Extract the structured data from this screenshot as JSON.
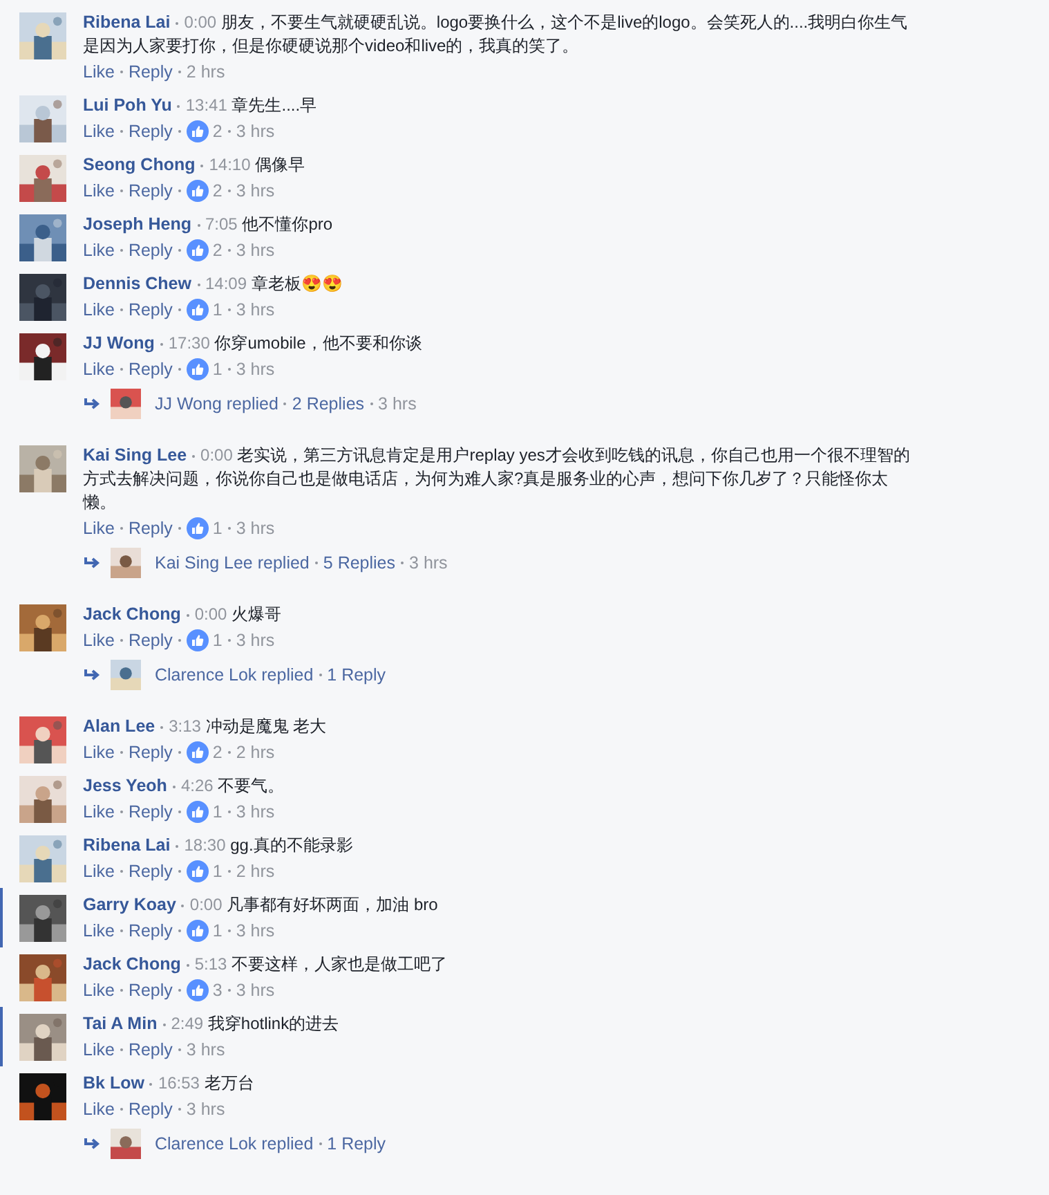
{
  "comments": [
    {
      "name": "Ribena Lai",
      "time": "0:00",
      "text": "朋友，不要生气就硬硬乱说。logo要换什么，这个不是live的logo。会笑死人的....我明白你生气是因为人家要打你，但是你硬硬说那个video和live的，我真的笑了。",
      "actions": [
        "Like",
        "Reply"
      ],
      "age": "2 hrs",
      "highlighted": false
    },
    {
      "name": "Lui Poh Yu",
      "time": "13:41",
      "text": "章先生....早",
      "actions": [
        "Like",
        "Reply"
      ],
      "likes": "2",
      "age": "3 hrs",
      "highlighted": false
    },
    {
      "name": "Seong Chong",
      "time": "14:10",
      "text": "偶像早",
      "actions": [
        "Like",
        "Reply"
      ],
      "likes": "2",
      "age": "3 hrs",
      "highlighted": false
    },
    {
      "name": "Joseph Heng",
      "time": "7:05",
      "text": "他不懂你pro",
      "actions": [
        "Like",
        "Reply"
      ],
      "likes": "2",
      "age": "3 hrs",
      "highlighted": false
    },
    {
      "name": "Dennis Chew",
      "time": "14:09",
      "text": "章老板😍😍",
      "actions": [
        "Like",
        "Reply"
      ],
      "likes": "1",
      "age": "3 hrs",
      "highlighted": false
    },
    {
      "name": "JJ Wong",
      "time": "17:30",
      "text": "你穿umobile，他不要和你谈",
      "actions": [
        "Like",
        "Reply"
      ],
      "likes": "1",
      "age": "3 hrs",
      "highlighted": false,
      "replies": {
        "label": "JJ Wong replied",
        "count": "2 Replies",
        "age": "3 hrs"
      }
    },
    {
      "name": "Kai Sing Lee",
      "time": "0:00",
      "text": "老实说，第三方讯息肯定是用户replay yes才会收到吃钱的讯息，你自己也用一个很不理智的方式去解决问题，你说你自己也是做电话店，为何为难人家?真是服务业的心声，想问下你几岁了？只能怪你太懒。",
      "actions": [
        "Like",
        "Reply"
      ],
      "likes": "1",
      "age": "3 hrs",
      "highlighted": false,
      "replies": {
        "label": "Kai Sing Lee replied",
        "count": "5 Replies",
        "age": "3 hrs"
      }
    },
    {
      "name": "Jack Chong",
      "time": "0:00",
      "text": "火爆哥",
      "actions": [
        "Like",
        "Reply"
      ],
      "likes": "1",
      "age": "3 hrs",
      "highlighted": false,
      "replies": {
        "label": "Clarence Lok replied",
        "count": "1 Reply"
      }
    },
    {
      "name": "Alan Lee",
      "time": "3:13",
      "text": "冲动是魔鬼 老大",
      "actions": [
        "Like",
        "Reply"
      ],
      "likes": "2",
      "age": "2 hrs",
      "highlighted": false
    },
    {
      "name": "Jess Yeoh",
      "time": "4:26",
      "text": "不要气。",
      "actions": [
        "Like",
        "Reply"
      ],
      "likes": "1",
      "age": "3 hrs",
      "highlighted": false
    },
    {
      "name": "Ribena Lai",
      "time": "18:30",
      "text": "gg.真的不能录影",
      "actions": [
        "Like",
        "Reply"
      ],
      "likes": "1",
      "age": "2 hrs",
      "highlighted": false
    },
    {
      "name": "Garry Koay",
      "time": "0:00",
      "text": "凡事都有好坏两面，加油 bro",
      "actions": [
        "Like",
        "Reply"
      ],
      "likes": "1",
      "age": "3 hrs",
      "highlighted": true
    },
    {
      "name": "Jack Chong",
      "time": "5:13",
      "text": "不要这样，人家也是做工吧了",
      "actions": [
        "Like",
        "Reply"
      ],
      "likes": "3",
      "age": "3 hrs",
      "highlighted": false
    },
    {
      "name": "Tai A Min",
      "time": "2:49",
      "text": "我穿hotlink的进去",
      "actions": [
        "Like",
        "Reply"
      ],
      "age": "3 hrs",
      "highlighted": true
    },
    {
      "name": "Bk Low",
      "time": "16:53",
      "text": "老万台",
      "actions": [
        "Like",
        "Reply"
      ],
      "age": "3 hrs",
      "highlighted": false,
      "replies": {
        "label": "Clarence Lok replied",
        "count": "1 Reply"
      }
    }
  ]
}
